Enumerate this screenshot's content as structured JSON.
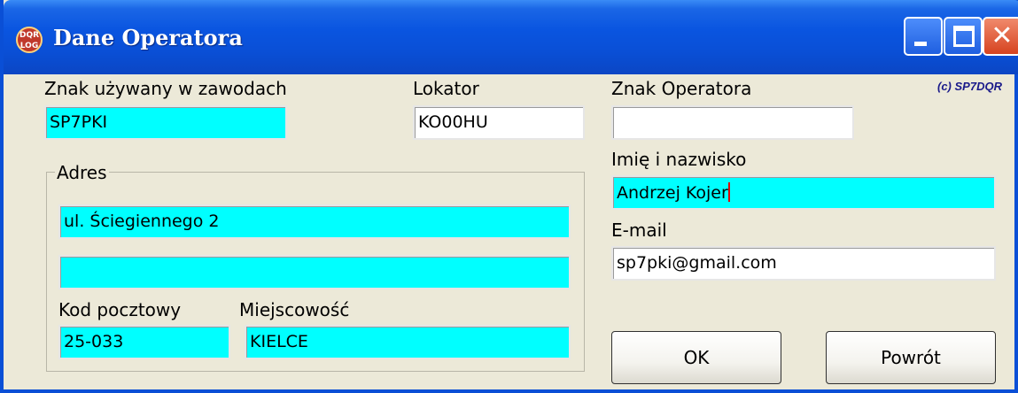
{
  "window": {
    "title": "Dane Operatora",
    "icon_text": "DQR LOG",
    "copyright": "(c) SP7DQR"
  },
  "fields": {
    "contest_call_label": "Znak używany w zawodach",
    "contest_call_value": "SP7PKI",
    "locator_label": "Lokator",
    "locator_value": "KO00HU",
    "operator_call_label": "Znak Operatora",
    "operator_call_value": "",
    "name_label": "Imię i nazwisko",
    "name_value": "Andrzej Kojer",
    "email_label": "E-mail",
    "email_value": "sp7pki@gmail.com"
  },
  "address": {
    "group_label": "Adres",
    "line1_value": "ul. Ściegiennego 2",
    "line2_value": "",
    "postal_label": "Kod pocztowy",
    "postal_value": "25-033",
    "city_label": "Miejscowość",
    "city_value": "KIELCE"
  },
  "buttons": {
    "ok_label": "OK",
    "back_label": "Powrót"
  },
  "colors": {
    "highlight_field": "#00ffff",
    "titlebar": "#0a4fd6",
    "window_bg": "#ece9d8"
  }
}
